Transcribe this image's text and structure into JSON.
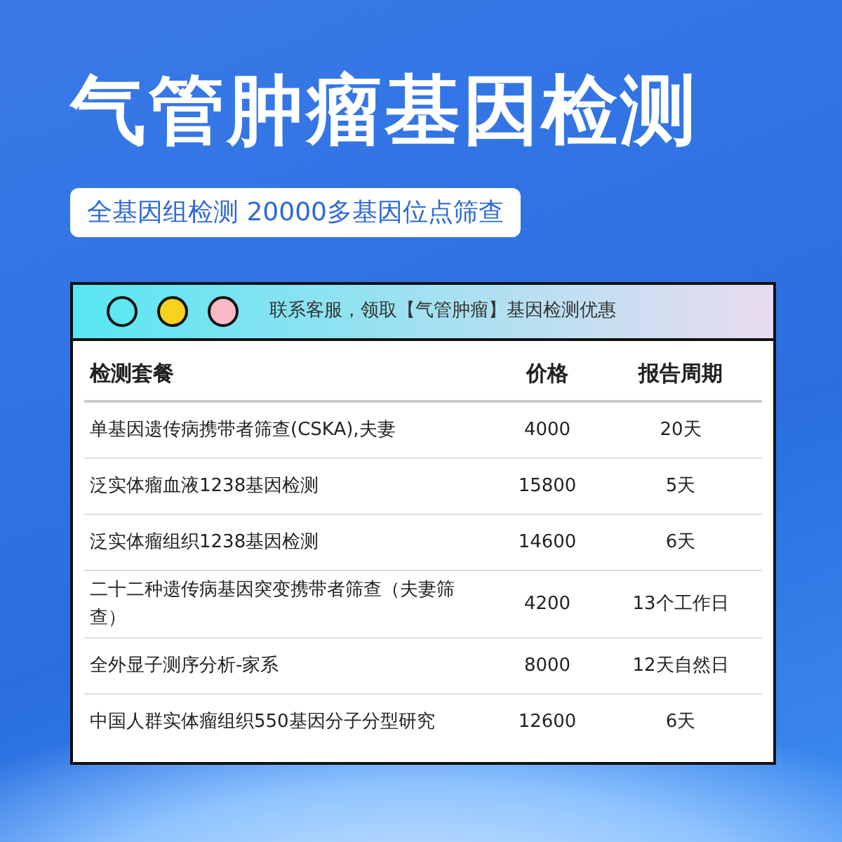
{
  "title": "气管肿瘤基因检测",
  "subtitle": "全基因组检测 20000多基因位点筛查",
  "window": {
    "dots": [
      {
        "color": "#5ce8f0"
      },
      {
        "color": "#f7d21e"
      },
      {
        "color": "#f9b9c6"
      }
    ],
    "notice": "联系客服，领取【气管肿瘤】基因检测优惠"
  },
  "table": {
    "columns": [
      "检测套餐",
      "价格",
      "报告周期"
    ],
    "rows": [
      [
        "单基因遗传病携带者筛查(CSKA),夫妻",
        "4000",
        "20天"
      ],
      [
        "泛实体瘤血液1238基因检测",
        "15800",
        "5天"
      ],
      [
        "泛实体瘤组织1238基因检测",
        "14600",
        "6天"
      ],
      [
        "二十二种遗传病基因突变携带者筛查（夫妻筛查）",
        "4200",
        "13个工作日"
      ],
      [
        "全外显子测序分析-家系",
        "8000",
        "12天自然日"
      ],
      [
        "中国人群实体瘤组织550基因分子分型研究",
        "12600",
        "6天"
      ]
    ]
  }
}
